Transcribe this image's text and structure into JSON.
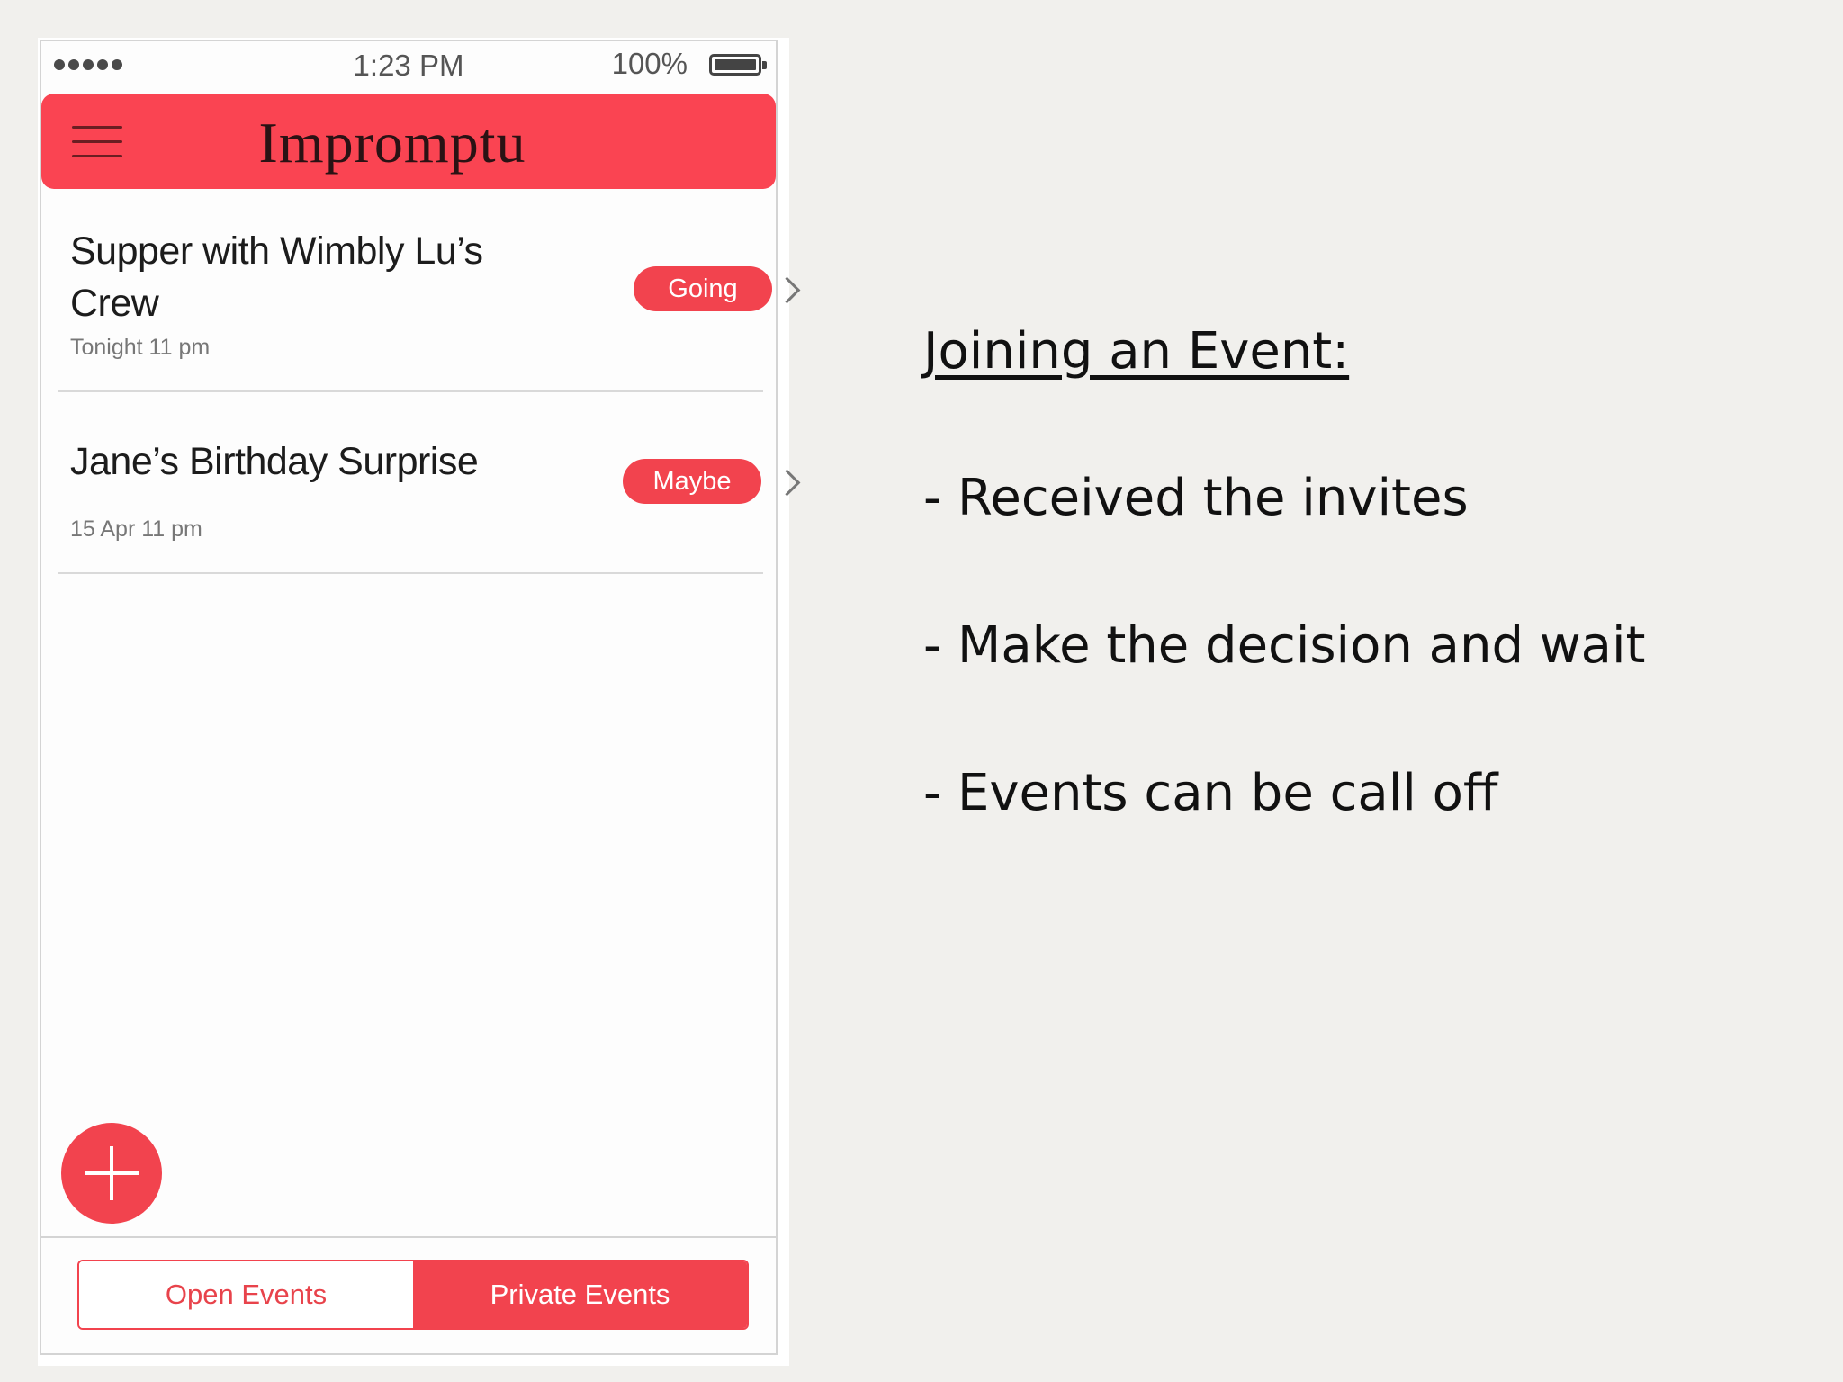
{
  "status_bar": {
    "time": "1:23 PM",
    "battery": "100%"
  },
  "app": {
    "title": "Impromptu"
  },
  "events": [
    {
      "title": "Supper with Wimbly Lu’s Crew",
      "time": "Tonight 11 pm",
      "status": "Going"
    },
    {
      "title": "Jane’s Birthday Surprise",
      "time": "15 Apr 11 pm",
      "status": "Maybe"
    }
  ],
  "tabs": {
    "open": "Open Events",
    "private": "Private Events",
    "selected": "Private Events"
  },
  "notes": {
    "heading": "Joining an Event:",
    "items": [
      "- Received the invites",
      "- Make the decision and wait",
      "- Events can be call off"
    ]
  },
  "colors": {
    "accent": "#fa4452",
    "badge": "#f2434e",
    "background": "#f1f0ed"
  }
}
